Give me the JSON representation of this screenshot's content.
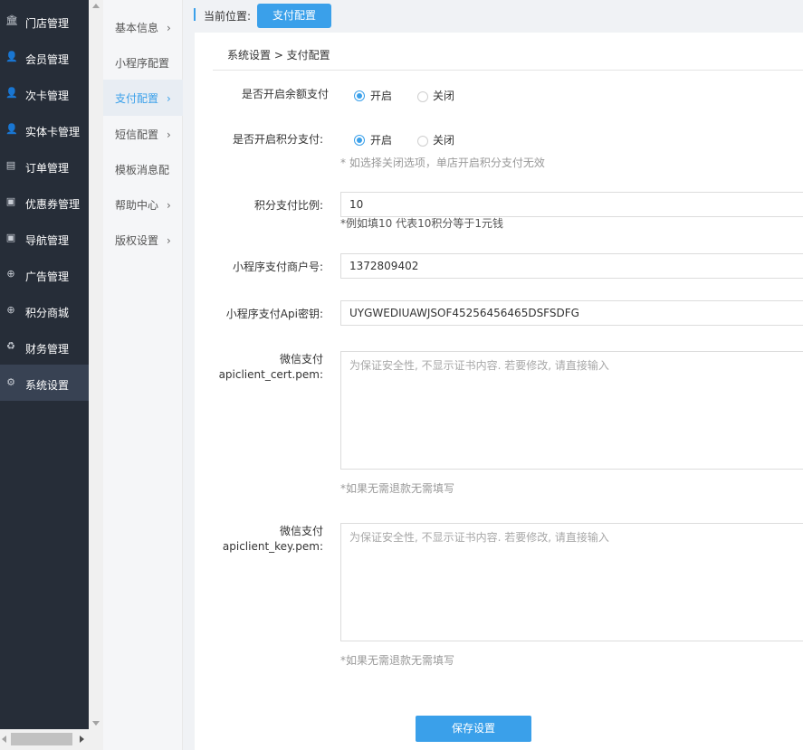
{
  "sidebar": {
    "items": [
      {
        "label": "门店管理",
        "icon": "bank-icon"
      },
      {
        "label": "会员管理",
        "icon": "user-icon"
      },
      {
        "label": "次卡管理",
        "icon": "user-icon"
      },
      {
        "label": "实体卡管理",
        "icon": "user-icon"
      },
      {
        "label": "订单管理",
        "icon": "document-icon"
      },
      {
        "label": "优惠券管理",
        "icon": "coupon-icon"
      },
      {
        "label": "导航管理",
        "icon": "coupon-icon"
      },
      {
        "label": "广告管理",
        "icon": "globe-icon"
      },
      {
        "label": "积分商城",
        "icon": "globe-icon"
      },
      {
        "label": "财务管理",
        "icon": "recycle-icon"
      },
      {
        "label": "系统设置",
        "icon": "gear-icon"
      }
    ],
    "active_index": 10
  },
  "submenu": {
    "items": [
      {
        "label": "基本信息",
        "chevron": true
      },
      {
        "label": "小程序配置",
        "chevron": false
      },
      {
        "label": "支付配置",
        "chevron": true
      },
      {
        "label": "短信配置",
        "chevron": true
      },
      {
        "label": "模板消息配",
        "chevron": false
      },
      {
        "label": "帮助中心",
        "chevron": true
      },
      {
        "label": "版权设置",
        "chevron": true
      }
    ],
    "active_index": 2,
    "chevron_glyph": "›"
  },
  "topbar": {
    "location_label": "当前位置:",
    "current_tag": "支付配置"
  },
  "panel": {
    "breadcrumb": "系统设置 > 支付配置",
    "balance_pay": {
      "label": "是否开启余额支付",
      "on_label": "开启",
      "off_label": "关闭",
      "selected": "on"
    },
    "points_pay": {
      "label": "是否开启积分支付:",
      "on_label": "开启",
      "off_label": "关闭",
      "selected": "on",
      "hint": "* 如选择关闭选项，单店开启积分支付无效"
    },
    "points_ratio": {
      "label": "积分支付比例:",
      "value": "10",
      "hint": "*例如填10 代表10积分等于1元钱"
    },
    "merchant_id": {
      "label": "小程序支付商户号:",
      "value": "1372809402"
    },
    "api_key": {
      "label": "小程序支付Api密钥:",
      "value": "UYGWEDIUAWJSOF45256456465DSFSDFG"
    },
    "cert_pem": {
      "label_line1": "微信支付",
      "label_line2": "apiclient_cert.pem:",
      "placeholder": "为保证安全性, 不显示证书内容. 若要修改, 请直接输入",
      "hint": "*如果无需退款无需填写"
    },
    "key_pem": {
      "label_line1": "微信支付",
      "label_line2": "apiclient_key.pem:",
      "placeholder": "为保证安全性, 不显示证书内容. 若要修改, 请直接输入",
      "hint": "*如果无需退款无需填写"
    },
    "save_label": "保存设置"
  },
  "colors": {
    "sidebar_bg": "#262d38",
    "accent": "#3aa0ea"
  }
}
